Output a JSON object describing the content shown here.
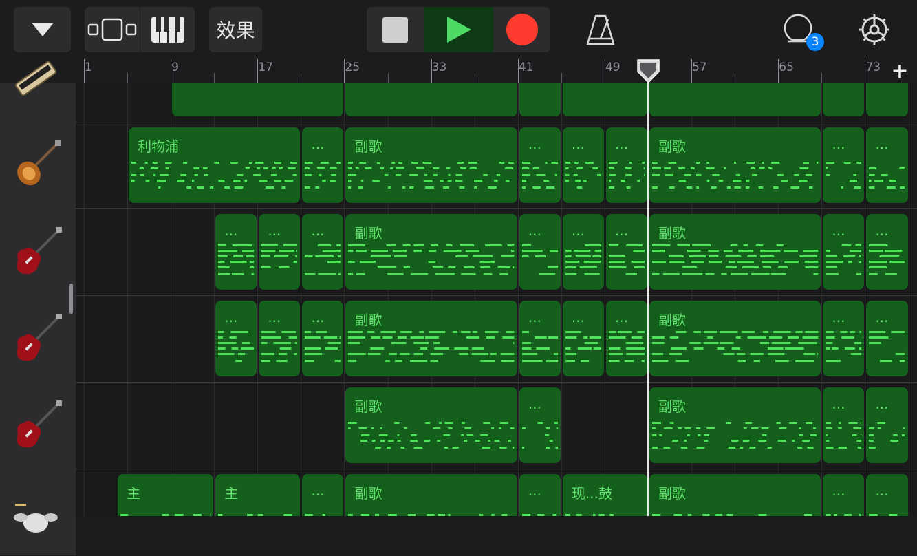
{
  "toolbar": {
    "effects_label": "效果",
    "loop_badge": "3"
  },
  "ruler": {
    "bar_labels": [
      "1",
      "9",
      "17",
      "25",
      "33",
      "41",
      "49",
      "57",
      "65",
      "73"
    ],
    "add_label": "+"
  },
  "tracks": [
    {
      "instrument": "organ-icon",
      "regions": [
        {
          "label": "",
          "start": 9,
          "end": 25
        },
        {
          "label": "",
          "start": 25,
          "end": 41
        },
        {
          "label": "",
          "start": 41,
          "end": 45
        },
        {
          "label": "",
          "start": 45,
          "end": 53
        },
        {
          "label": "",
          "start": 53,
          "end": 69
        },
        {
          "label": "",
          "start": 69,
          "end": 73
        },
        {
          "label": "",
          "start": 73,
          "end": 77
        }
      ]
    },
    {
      "instrument": "bass-guitar-icon",
      "regions": [
        {
          "label": "利物浦",
          "start": 5,
          "end": 21
        },
        {
          "label": "...",
          "start": 21,
          "end": 25
        },
        {
          "label": "副歌",
          "start": 25,
          "end": 41
        },
        {
          "label": "...",
          "start": 41,
          "end": 45
        },
        {
          "label": "...",
          "start": 45,
          "end": 49
        },
        {
          "label": "...",
          "start": 49,
          "end": 53
        },
        {
          "label": "副歌",
          "start": 53,
          "end": 69
        },
        {
          "label": "...",
          "start": 69,
          "end": 73
        },
        {
          "label": "...",
          "start": 73,
          "end": 77
        }
      ]
    },
    {
      "instrument": "electric-guitar-icon",
      "regions": [
        {
          "label": "...",
          "start": 13,
          "end": 17
        },
        {
          "label": "...",
          "start": 17,
          "end": 21
        },
        {
          "label": "...",
          "start": 21,
          "end": 25
        },
        {
          "label": "副歌",
          "start": 25,
          "end": 41
        },
        {
          "label": "...",
          "start": 41,
          "end": 45
        },
        {
          "label": "...",
          "start": 45,
          "end": 49
        },
        {
          "label": "...",
          "start": 49,
          "end": 53
        },
        {
          "label": "副歌",
          "start": 53,
          "end": 69
        },
        {
          "label": "...",
          "start": 69,
          "end": 73
        },
        {
          "label": "...",
          "start": 73,
          "end": 77
        }
      ]
    },
    {
      "instrument": "electric-guitar-icon",
      "regions": [
        {
          "label": "...",
          "start": 13,
          "end": 17
        },
        {
          "label": "...",
          "start": 17,
          "end": 21
        },
        {
          "label": "...",
          "start": 21,
          "end": 25
        },
        {
          "label": "副歌",
          "start": 25,
          "end": 41
        },
        {
          "label": "...",
          "start": 41,
          "end": 45
        },
        {
          "label": "...",
          "start": 45,
          "end": 49
        },
        {
          "label": "...",
          "start": 49,
          "end": 53
        },
        {
          "label": "副歌",
          "start": 53,
          "end": 69
        },
        {
          "label": "...",
          "start": 69,
          "end": 73
        },
        {
          "label": "...",
          "start": 73,
          "end": 77
        }
      ]
    },
    {
      "instrument": "electric-guitar-icon",
      "regions": [
        {
          "label": "副歌",
          "start": 25,
          "end": 41
        },
        {
          "label": "...",
          "start": 41,
          "end": 45
        },
        {
          "label": "副歌",
          "start": 53,
          "end": 69
        },
        {
          "label": "...",
          "start": 69,
          "end": 73
        },
        {
          "label": "...",
          "start": 73,
          "end": 77
        }
      ]
    },
    {
      "instrument": "drum-kit-icon",
      "regions": [
        {
          "label": "主",
          "start": 4,
          "end": 13
        },
        {
          "label": "主",
          "start": 13,
          "end": 21
        },
        {
          "label": "...",
          "start": 21,
          "end": 25
        },
        {
          "label": "副歌",
          "start": 25,
          "end": 41
        },
        {
          "label": "...",
          "start": 41,
          "end": 45
        },
        {
          "label": "现...鼓",
          "start": 45,
          "end": 53
        },
        {
          "label": "副歌",
          "start": 53,
          "end": 69
        },
        {
          "label": "...",
          "start": 69,
          "end": 73
        },
        {
          "label": "...",
          "start": 73,
          "end": 77
        }
      ]
    }
  ],
  "playhead_bar": 52,
  "colors": {
    "region_bg": "#135f1b",
    "region_text": "#5fe06a",
    "notes": "#4fe35a",
    "record": "#ff3b30",
    "play": "#4cd964",
    "badge": "#0a84ff"
  }
}
